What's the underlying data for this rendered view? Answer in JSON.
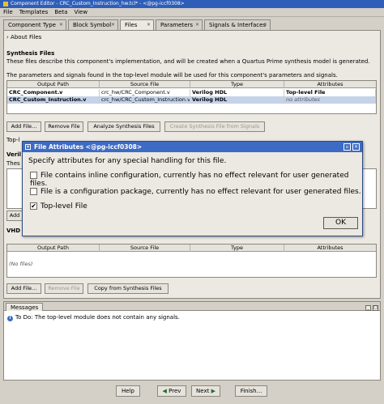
{
  "window": {
    "title": "Component Editor - CRC_Custom_Instruction_hw.tcl* - <@pg-iccf0308>"
  },
  "menu": [
    "File",
    "Templates",
    "Beta",
    "View"
  ],
  "tabs": [
    {
      "label": "Component Type"
    },
    {
      "label": "Block Symbol"
    },
    {
      "label": "Files"
    },
    {
      "label": "Parameters"
    },
    {
      "label": "Signals & Interfaces"
    }
  ],
  "about": "About Files",
  "synthesis": {
    "title": "Synthesis Files",
    "desc1": "These files describe this component's implementation, and will be created when a Quartus Prime synthesis model is generated.",
    "desc2": "The parameters and signals found in the top-level module will be used for this component's parameters and signals.",
    "columns": [
      "Output Path",
      "Source File",
      "Type",
      "Attributes"
    ],
    "rows": [
      {
        "path": "CRC_Component.v",
        "source": "crc_hw/CRC_Component.v",
        "type": "Verilog HDL",
        "attr": "Top-level File"
      },
      {
        "path": "CRC_Custom_Instruction.v",
        "source": "crc_hw/CRC_Custom_Instruction.v",
        "type": "Verilog HDL",
        "attr": "no attributes"
      }
    ],
    "buttons": {
      "add": "Add File...",
      "remove": "Remove File",
      "analyze": "Analyze Synthesis Files",
      "create": "Create Synthesis File from Signals"
    },
    "toplevel_label": "Top-l"
  },
  "verilog": {
    "title": "Veril",
    "desc": "Thes"
  },
  "vhdl": {
    "title": "VHD",
    "columns": [
      "Output Path",
      "Source File",
      "Type",
      "Attributes"
    ],
    "empty": "(No files)",
    "buttons": {
      "add": "Add File...",
      "remove": "Remove File",
      "copy": "Copy from Synthesis Files"
    }
  },
  "partial_add": "Add",
  "messages": {
    "tab": "Messages",
    "line": "To Do: The top-level module does not contain any signals."
  },
  "footer": {
    "help": "Help",
    "prev": "Prev",
    "next": "Next",
    "finish": "Finish..."
  },
  "dialog": {
    "title": "File Attributes <@pg-iccf0308>",
    "prompt": "Specify attributes for any special handling for this file.",
    "options": [
      {
        "label": "File contains inline configuration, currently has no effect relevant for user generated files.",
        "checked": false
      },
      {
        "label": "File is a configuration package, currently has no effect relevant for user generated files.",
        "checked": false
      },
      {
        "label": "Top-level File",
        "checked": true
      }
    ],
    "ok": "OK",
    "check_mark": "✔"
  }
}
